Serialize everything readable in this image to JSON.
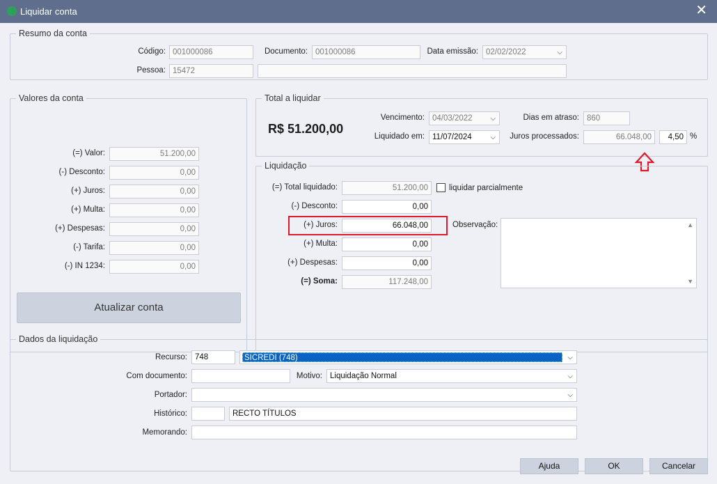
{
  "window": {
    "title": "Liquidar conta"
  },
  "resumo": {
    "legend": "Resumo da conta",
    "codigo_label": "Código:",
    "codigo": "001000086",
    "documento_label": "Documento:",
    "documento": "001000086",
    "data_emissao_label": "Data emissão:",
    "data_emissao": "02/02/2022",
    "pessoa_label": "Pessoa:",
    "pessoa_id": "15472",
    "pessoa_nome": ""
  },
  "valores": {
    "legend": "Valores da conta",
    "rows": [
      {
        "label": "(=) Valor:",
        "value": "51.200,00"
      },
      {
        "label": "(-) Desconto:",
        "value": "0,00"
      },
      {
        "label": "(+) Juros:",
        "value": "0,00"
      },
      {
        "label": "(+) Multa:",
        "value": "0,00"
      },
      {
        "label": "(+) Despesas:",
        "value": "0,00"
      },
      {
        "label": "(-) Tarifa:",
        "value": "0,00"
      },
      {
        "label": "(-) IN 1234:",
        "value": "0,00"
      }
    ],
    "atualizar_label": "Atualizar conta"
  },
  "total": {
    "legend": "Total a liquidar",
    "amount": "R$ 51.200,00",
    "vencimento_label": "Vencimento:",
    "vencimento": "04/03/2022",
    "liquidado_label": "Liquidado em:",
    "liquidado": "11/07/2024",
    "dias_label": "Dias em atraso:",
    "dias": "860",
    "juros_label": "Juros processados:",
    "juros": "66.048,00",
    "taxa": "4,50",
    "taxa_unit": "%"
  },
  "liquidacao": {
    "legend": "Liquidação",
    "total_label": "(=) Total liquidado:",
    "total": "51.200,00",
    "parcial_label": "liquidar parcialmente",
    "desconto_label": "(-) Desconto:",
    "desconto": "0,00",
    "juros_label": "(+) Juros:",
    "juros": "66.048,00",
    "multa_label": "(+) Multa:",
    "multa": "0,00",
    "despesas_label": "(+) Despesas:",
    "despesas": "0,00",
    "soma_label": "(=) Soma:",
    "soma": "117.248,00",
    "obs_label": "Observação:",
    "obs": ""
  },
  "dados": {
    "legend": "Dados da liquidação",
    "recurso_label": "Recurso:",
    "recurso_code": "748",
    "recurso_name": "SICREDI (748)",
    "comdoc_label": "Com documento:",
    "comdoc": "",
    "motivo_label": "Motivo:",
    "motivo": "Liquidação Normal",
    "portador_label": "Portador:",
    "portador": "",
    "historico_label": "Histórico:",
    "historico_code": "",
    "historico_text": "RECTO TÍTULOS",
    "memorando_label": "Memorando:",
    "memorando": ""
  },
  "buttons": {
    "ajuda": "Ajuda",
    "ok": "OK",
    "cancelar": "Cancelar"
  },
  "colors": {
    "titlebar": "#5e6e8c",
    "highlight": "#e0192a",
    "selection": "#0a63c4"
  },
  "icons": {
    "app": "app-logo-icon",
    "close": "close-icon",
    "arrow": "up-arrow-icon"
  }
}
